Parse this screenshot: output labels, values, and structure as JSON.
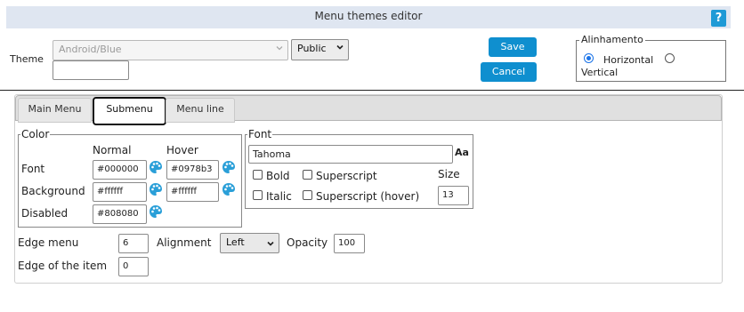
{
  "window": {
    "title": "Menu themes editor",
    "help_label": "?"
  },
  "theme": {
    "label": "Theme",
    "selected": "Android/Blue",
    "visibility": "Public",
    "name_value": ""
  },
  "buttons": {
    "save": "Save",
    "cancel": "Cancel"
  },
  "alignment_box": {
    "legend": "Alinhamento",
    "horizontal": "Horizontal",
    "vertical": "Vertical",
    "selected": "Horizontal"
  },
  "tabs": [
    {
      "label": "Main Menu",
      "active": false
    },
    {
      "label": "Submenu",
      "active": true
    },
    {
      "label": "Menu line",
      "active": false
    }
  ],
  "color": {
    "legend": "Color",
    "normal_header": "Normal",
    "hover_header": "Hover",
    "rows": [
      {
        "label": "Font",
        "normal": "#000000",
        "hover": "#0978b3"
      },
      {
        "label": "Background",
        "normal": "#ffffff",
        "hover": "#ffffff"
      },
      {
        "label": "Disabled",
        "normal": "#808080",
        "hover": ""
      }
    ]
  },
  "font": {
    "legend": "Font",
    "family": "Tahoma",
    "bold": "Bold",
    "italic": "Italic",
    "superscript": "Superscript",
    "superscript_hover": "Superscript (hover)",
    "size_label": "Size",
    "size": "13",
    "icon_text": "Aa"
  },
  "edge_menu": {
    "label": "Edge menu",
    "value": "6"
  },
  "align": {
    "label": "Alignment",
    "value": "Left"
  },
  "opacity": {
    "label": "Opacity",
    "value": "100"
  },
  "edge_item": {
    "label": "Edge of the item",
    "value": "0"
  },
  "colors": {
    "primary_button": "#0f8fcf",
    "title_bar": "#dfe6f1",
    "palette_icon": "#2a9fd8"
  }
}
